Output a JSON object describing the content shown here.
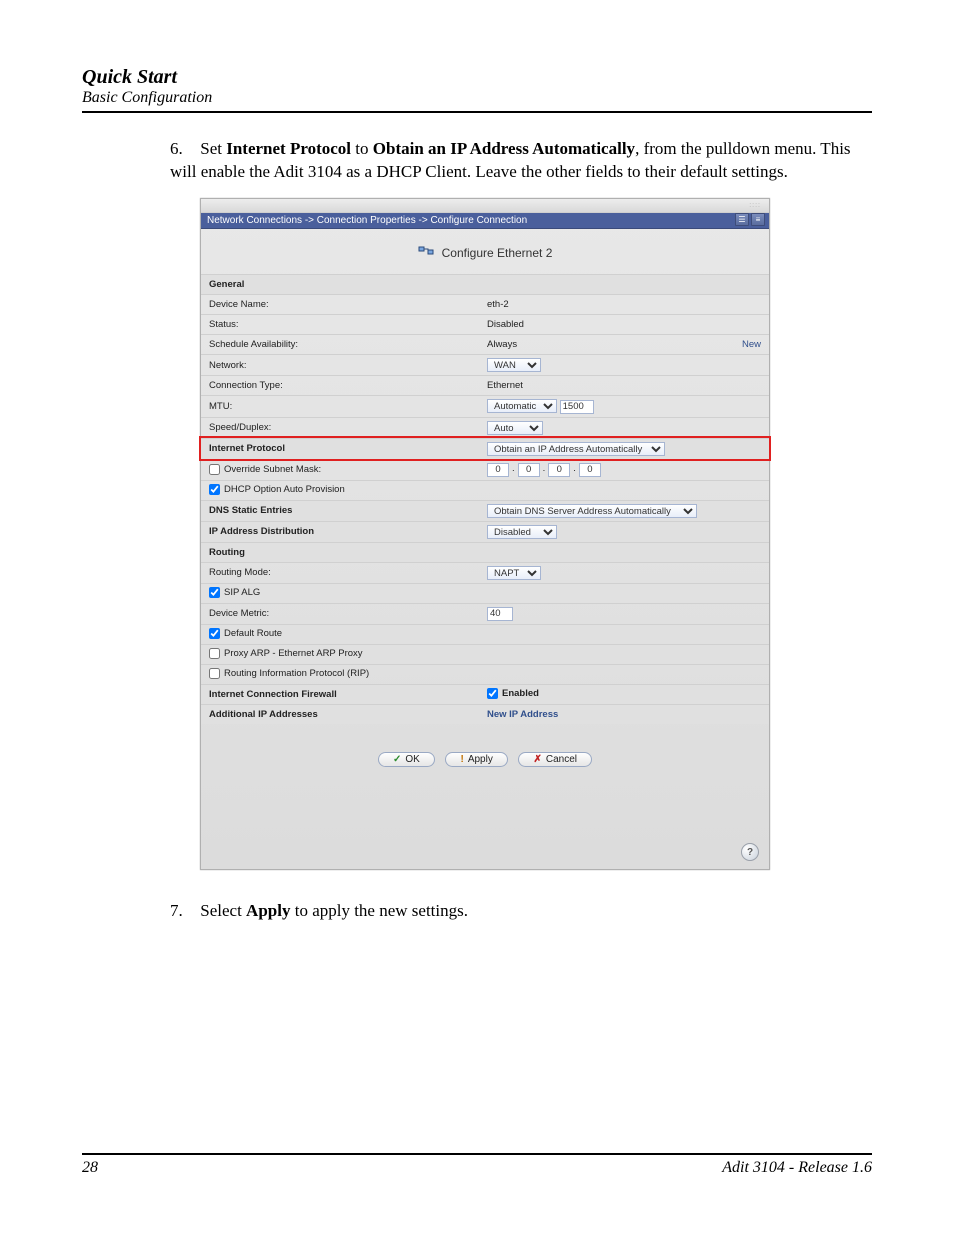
{
  "header": {
    "title": "Quick Start",
    "subtitle": "Basic Configuration"
  },
  "step6": {
    "num": "6.",
    "t1": "Set ",
    "b1": "Internet Protocol",
    "t2": " to ",
    "b2": "Obtain an IP Address Automatically",
    "t3": ", from the pulldown menu. This will enable the Adit 3104 as a DHCP Client. Leave the other fields to their default settings."
  },
  "step7": {
    "num": "7.",
    "t1": "Select ",
    "b1": "Apply",
    "t2": " to apply the new settings."
  },
  "shot": {
    "breadcrumb": "Network Connections -> Connection Properties -> Configure Connection",
    "title": "Configure Ethernet 2",
    "sections": {
      "general": "General",
      "internet_protocol": "Internet Protocol",
      "dns_static": "DNS Static Entries",
      "ip_dist": "IP Address Distribution",
      "routing": "Routing",
      "firewall": "Internet Connection Firewall",
      "additional_ip": "Additional IP Addresses"
    },
    "rows": {
      "device_name": {
        "label": "Device Name:",
        "value": "eth-2"
      },
      "status": {
        "label": "Status:",
        "value": "Disabled"
      },
      "schedule": {
        "label": "Schedule Availability:",
        "value": "Always",
        "link": "New"
      },
      "network": {
        "label": "Network:",
        "select": "WAN"
      },
      "conn_type": {
        "label": "Connection Type:",
        "value": "Ethernet"
      },
      "mtu": {
        "label": "MTU:",
        "select": "Automatic",
        "input": "1500"
      },
      "speed": {
        "label": "Speed/Duplex:",
        "select": "Auto"
      },
      "ip_method": {
        "select": "Obtain an IP Address Automatically"
      },
      "override_mask": {
        "label": "Override Subnet Mask:",
        "oct": [
          "0",
          "0",
          "0",
          "0"
        ]
      },
      "dhcp_auto": {
        "label": "DHCP Option Auto Provision"
      },
      "dns": {
        "select": "Obtain DNS Server Address Automatically"
      },
      "ip_dist": {
        "select": "Disabled"
      },
      "routing_mode": {
        "label": "Routing Mode:",
        "select": "NAPT"
      },
      "sip_alg": {
        "label": "SIP ALG"
      },
      "device_metric": {
        "label": "Device Metric:",
        "input": "40"
      },
      "default_route": {
        "label": "Default Route"
      },
      "proxy_arp": {
        "label": "Proxy ARP - Ethernet ARP Proxy"
      },
      "rip": {
        "label": "Routing Information Protocol (RIP)"
      },
      "fw_enabled": {
        "label": "Enabled"
      },
      "new_ip": {
        "label": "New IP Address"
      }
    },
    "buttons": {
      "ok": "OK",
      "apply": "Apply",
      "cancel": "Cancel"
    },
    "help": "?"
  },
  "footer": {
    "page": "28",
    "product": "Adit 3104  -  Release 1.6"
  }
}
